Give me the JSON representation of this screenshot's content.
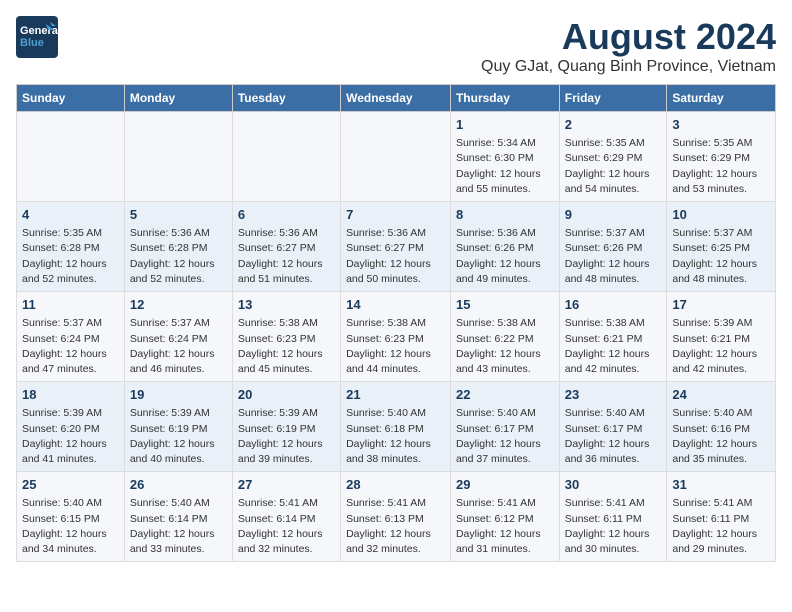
{
  "header": {
    "logo_general": "General",
    "logo_blue": "Blue",
    "main_title": "August 2024",
    "subtitle": "Quy GJat, Quang Binh Province, Vietnam"
  },
  "calendar": {
    "days_of_week": [
      "Sunday",
      "Monday",
      "Tuesday",
      "Wednesday",
      "Thursday",
      "Friday",
      "Saturday"
    ],
    "weeks": [
      [
        {
          "day": "",
          "info": ""
        },
        {
          "day": "",
          "info": ""
        },
        {
          "day": "",
          "info": ""
        },
        {
          "day": "",
          "info": ""
        },
        {
          "day": "1",
          "info": "Sunrise: 5:34 AM\nSunset: 6:30 PM\nDaylight: 12 hours and 55 minutes."
        },
        {
          "day": "2",
          "info": "Sunrise: 5:35 AM\nSunset: 6:29 PM\nDaylight: 12 hours and 54 minutes."
        },
        {
          "day": "3",
          "info": "Sunrise: 5:35 AM\nSunset: 6:29 PM\nDaylight: 12 hours and 53 minutes."
        }
      ],
      [
        {
          "day": "4",
          "info": "Sunrise: 5:35 AM\nSunset: 6:28 PM\nDaylight: 12 hours and 52 minutes."
        },
        {
          "day": "5",
          "info": "Sunrise: 5:36 AM\nSunset: 6:28 PM\nDaylight: 12 hours and 52 minutes."
        },
        {
          "day": "6",
          "info": "Sunrise: 5:36 AM\nSunset: 6:27 PM\nDaylight: 12 hours and 51 minutes."
        },
        {
          "day": "7",
          "info": "Sunrise: 5:36 AM\nSunset: 6:27 PM\nDaylight: 12 hours and 50 minutes."
        },
        {
          "day": "8",
          "info": "Sunrise: 5:36 AM\nSunset: 6:26 PM\nDaylight: 12 hours and 49 minutes."
        },
        {
          "day": "9",
          "info": "Sunrise: 5:37 AM\nSunset: 6:26 PM\nDaylight: 12 hours and 48 minutes."
        },
        {
          "day": "10",
          "info": "Sunrise: 5:37 AM\nSunset: 6:25 PM\nDaylight: 12 hours and 48 minutes."
        }
      ],
      [
        {
          "day": "11",
          "info": "Sunrise: 5:37 AM\nSunset: 6:24 PM\nDaylight: 12 hours and 47 minutes."
        },
        {
          "day": "12",
          "info": "Sunrise: 5:37 AM\nSunset: 6:24 PM\nDaylight: 12 hours and 46 minutes."
        },
        {
          "day": "13",
          "info": "Sunrise: 5:38 AM\nSunset: 6:23 PM\nDaylight: 12 hours and 45 minutes."
        },
        {
          "day": "14",
          "info": "Sunrise: 5:38 AM\nSunset: 6:23 PM\nDaylight: 12 hours and 44 minutes."
        },
        {
          "day": "15",
          "info": "Sunrise: 5:38 AM\nSunset: 6:22 PM\nDaylight: 12 hours and 43 minutes."
        },
        {
          "day": "16",
          "info": "Sunrise: 5:38 AM\nSunset: 6:21 PM\nDaylight: 12 hours and 42 minutes."
        },
        {
          "day": "17",
          "info": "Sunrise: 5:39 AM\nSunset: 6:21 PM\nDaylight: 12 hours and 42 minutes."
        }
      ],
      [
        {
          "day": "18",
          "info": "Sunrise: 5:39 AM\nSunset: 6:20 PM\nDaylight: 12 hours and 41 minutes."
        },
        {
          "day": "19",
          "info": "Sunrise: 5:39 AM\nSunset: 6:19 PM\nDaylight: 12 hours and 40 minutes."
        },
        {
          "day": "20",
          "info": "Sunrise: 5:39 AM\nSunset: 6:19 PM\nDaylight: 12 hours and 39 minutes."
        },
        {
          "day": "21",
          "info": "Sunrise: 5:40 AM\nSunset: 6:18 PM\nDaylight: 12 hours and 38 minutes."
        },
        {
          "day": "22",
          "info": "Sunrise: 5:40 AM\nSunset: 6:17 PM\nDaylight: 12 hours and 37 minutes."
        },
        {
          "day": "23",
          "info": "Sunrise: 5:40 AM\nSunset: 6:17 PM\nDaylight: 12 hours and 36 minutes."
        },
        {
          "day": "24",
          "info": "Sunrise: 5:40 AM\nSunset: 6:16 PM\nDaylight: 12 hours and 35 minutes."
        }
      ],
      [
        {
          "day": "25",
          "info": "Sunrise: 5:40 AM\nSunset: 6:15 PM\nDaylight: 12 hours and 34 minutes."
        },
        {
          "day": "26",
          "info": "Sunrise: 5:40 AM\nSunset: 6:14 PM\nDaylight: 12 hours and 33 minutes."
        },
        {
          "day": "27",
          "info": "Sunrise: 5:41 AM\nSunset: 6:14 PM\nDaylight: 12 hours and 32 minutes."
        },
        {
          "day": "28",
          "info": "Sunrise: 5:41 AM\nSunset: 6:13 PM\nDaylight: 12 hours and 32 minutes."
        },
        {
          "day": "29",
          "info": "Sunrise: 5:41 AM\nSunset: 6:12 PM\nDaylight: 12 hours and 31 minutes."
        },
        {
          "day": "30",
          "info": "Sunrise: 5:41 AM\nSunset: 6:11 PM\nDaylight: 12 hours and 30 minutes."
        },
        {
          "day": "31",
          "info": "Sunrise: 5:41 AM\nSunset: 6:11 PM\nDaylight: 12 hours and 29 minutes."
        }
      ]
    ]
  }
}
